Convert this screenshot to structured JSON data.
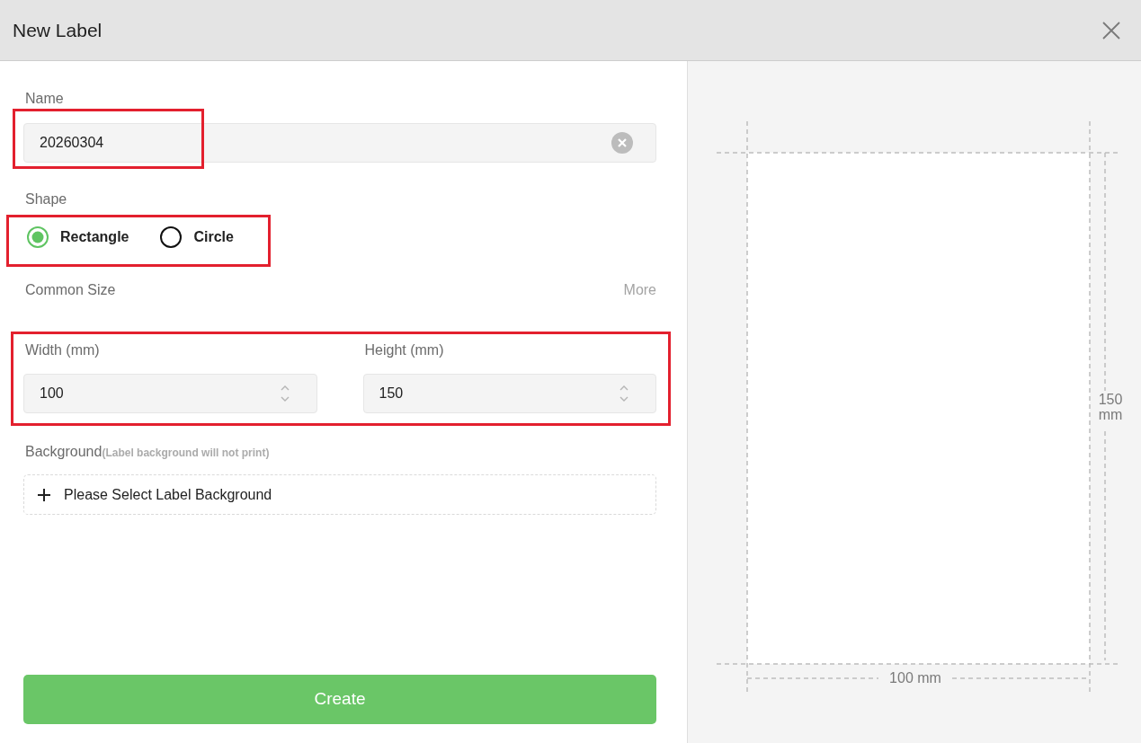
{
  "window": {
    "title": "New Label"
  },
  "form": {
    "name": {
      "label": "Name",
      "value": "20260304",
      "highlighted": true
    },
    "shape": {
      "label": "Shape",
      "highlighted": true,
      "options": [
        {
          "label": "Rectangle",
          "selected": true
        },
        {
          "label": "Circle",
          "selected": false
        }
      ]
    },
    "common_size": {
      "label": "Common Size",
      "more": "More"
    },
    "size": {
      "highlighted": true,
      "fields": [
        {
          "label": "Width (mm)",
          "value": "100"
        },
        {
          "label": "Height (mm)",
          "value": "150"
        }
      ]
    },
    "background": {
      "label": "Background",
      "note": "(Label background will not print)",
      "button": "Please Select Label Background"
    },
    "submit": "Create"
  },
  "preview": {
    "width_label": "100 mm",
    "height_label": "150 mm"
  }
}
